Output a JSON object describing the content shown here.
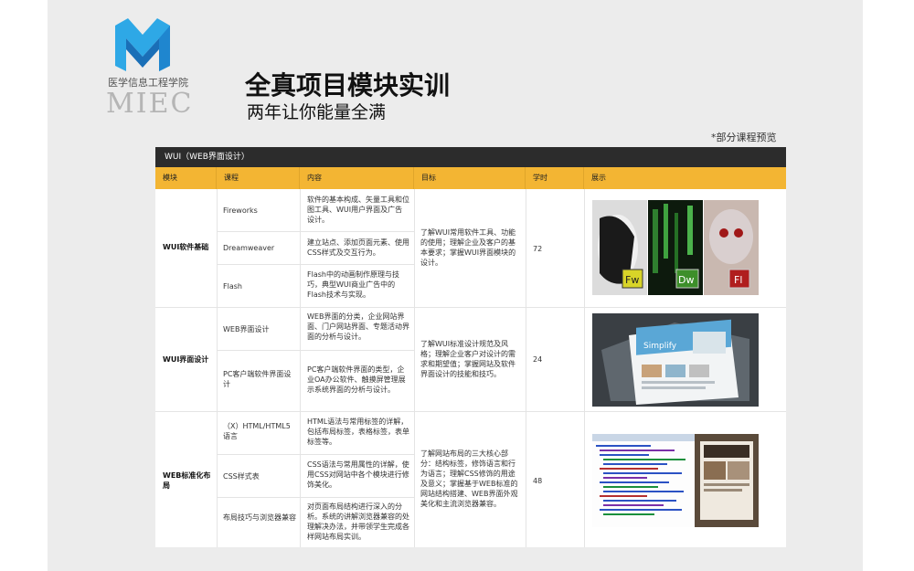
{
  "logo": {
    "cn": "医学信息工程学院",
    "en": "MIEC",
    "colors": {
      "blue_light": "#2ea8e6",
      "blue_dark": "#1a6fb7"
    }
  },
  "header": {
    "title": "全真项目模块实训",
    "subtitle": "两年让你能量全满",
    "note": "*部分课程预览"
  },
  "table": {
    "bar_title": "WUI（WEB界面设计）",
    "columns": [
      "模块",
      "课程",
      "内容",
      "目标",
      "学时",
      "展示"
    ],
    "modules": [
      {
        "name": "WUI软件基础",
        "target": "了解WUI常用软件工具、功能的使用；理解企业及客户的基本要求；掌握WUI界面模块的设计。",
        "hours": "72",
        "showcase_icon": "adobe-cs-apps-image",
        "courses": [
          {
            "name": "Fireworks",
            "content": "软件的基本构成、矢量工具和位图工具、WUI用户界面及广告设计。"
          },
          {
            "name": "Dreamweaver",
            "content": "建立站点、添加页面元素、使用CSS样式及交互行为。"
          },
          {
            "name": "Flash",
            "content": "Flash中的动画制作原理与技巧，典型WUI商业广告中的Flash技术与实现。"
          }
        ]
      },
      {
        "name": "WUI界面设计",
        "target": "了解WUI标准设计规范及风格；理解企业客户对设计的需求和期望值；掌握网站及软件界面设计的技能和技巧。",
        "hours": "24",
        "showcase_icon": "website-design-image",
        "courses": [
          {
            "name": "WEB界面设计",
            "content": "WEB界面的分类，企业网站界面、门户网站界面、专题活动界面的分析与设计。"
          },
          {
            "name": "PC客户端软件界面设计",
            "content": "PC客户端软件界面的类型，企业OA办公软件、触摸屏管理展示系统界面的分析与设计。"
          }
        ]
      },
      {
        "name": "WEB标准化布局",
        "target": "了解网站布局的三大核心部分：结构标签，修饰语言和行为语言；理解CSS修饰的用途及意义；掌握基于WEB标准的网站结构搭建、WEB界面外观美化和主流浏览器兼容。",
        "hours": "48",
        "showcase_icon": "code-editor-image",
        "courses": [
          {
            "name": "（X）HTML/HTML5语言",
            "content": "HTML语法与常用标签的详解，包括布局标签，表格标签，表单标签等。"
          },
          {
            "name": "CSS样式表",
            "content": "CSS语法与常用属性的详解，使用CSS对网站中各个模块进行修饰美化。"
          },
          {
            "name": "布局技巧与浏览器兼容",
            "content": "对页面布局结构进行深入的分析。系统的讲解浏览器兼容的处理解决办法，并带领学生完成各样网站布局实训。"
          }
        ]
      }
    ]
  }
}
